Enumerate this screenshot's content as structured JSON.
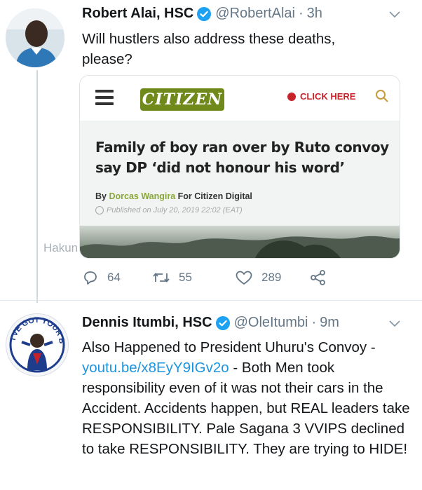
{
  "tweet1": {
    "name": "Robert Alai, HSC",
    "handle": "@RobertAlai",
    "separator": "·",
    "time": "3h",
    "text": "Will hustlers also address these deaths, please?",
    "card": {
      "logo_text": "CITIZEN",
      "click_here": "CLICK HERE",
      "headline": "Family of boy ran over by Ruto convoy say DP ‘did not honour his word’",
      "byline_prefix": "By",
      "byline_author": "Dorcas Wangira",
      "byline_suffix": "For Citizen Digital",
      "published": "Published on  July 20, 2019 22:02 (EAT)"
    },
    "watermark": "Hakun",
    "stats": {
      "replies": "64",
      "retweets": "55",
      "likes": "289"
    }
  },
  "tweet2": {
    "name": "Dennis Itumbi, HSC",
    "handle": "@OleItumbi",
    "separator": "·",
    "time": "9m",
    "avatar_text": "I'VE GOT YOUR BACK",
    "text_before_link": "Also Happened to President Uhuru's Convoy -",
    "link": "youtu.be/x8EyY9IGv2o",
    "text_after_link": "- Both Men took responsibility even of it was not their cars in the Accident. Accidents happen, but REAL leaders take RESPONSIBILITY. Pale Sagana 3 VVIPS declined to take RESPONSIBILITY. They are trying to HIDE!"
  },
  "colors": {
    "link": "#1b95e0",
    "verified": "#1da1f2",
    "muted": "#657786",
    "citizen_green": "#6f8a1a",
    "click_red": "#c5222a"
  },
  "icons": [
    "verified-badge-icon",
    "chevron-down-icon",
    "reply-icon",
    "retweet-icon",
    "like-icon",
    "share-icon",
    "hamburger-menu-icon",
    "search-icon"
  ]
}
